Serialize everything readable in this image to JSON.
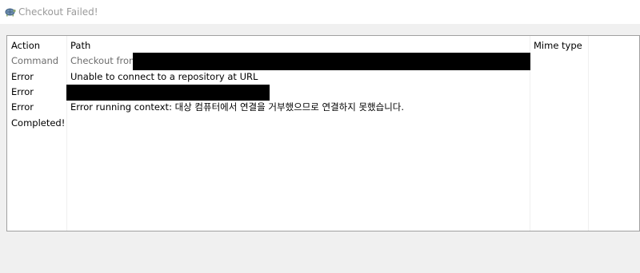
{
  "window": {
    "title": "Checkout Failed!",
    "icon": "tortoise-icon"
  },
  "log": {
    "columns": [
      "Action",
      "Path",
      "Mime type"
    ],
    "rows": [
      {
        "action": "Command",
        "path": "Checkout from",
        "redacted": true
      },
      {
        "action": "Error",
        "path": "Unable to connect to a repository at URL",
        "redacted": false
      },
      {
        "action": "Error",
        "path": "",
        "redacted": true
      },
      {
        "action": "Error",
        "path": "Error running context: 대상 컴퓨터에서 연결을 거부했으므로 연결하지 못했습니다.",
        "redacted": false
      },
      {
        "action": "Completed!",
        "path": "",
        "redacted": false
      }
    ]
  },
  "colors": {
    "title_text": "#9a9a9a",
    "command_text": "#6d6d6d",
    "redaction": "#000000"
  }
}
